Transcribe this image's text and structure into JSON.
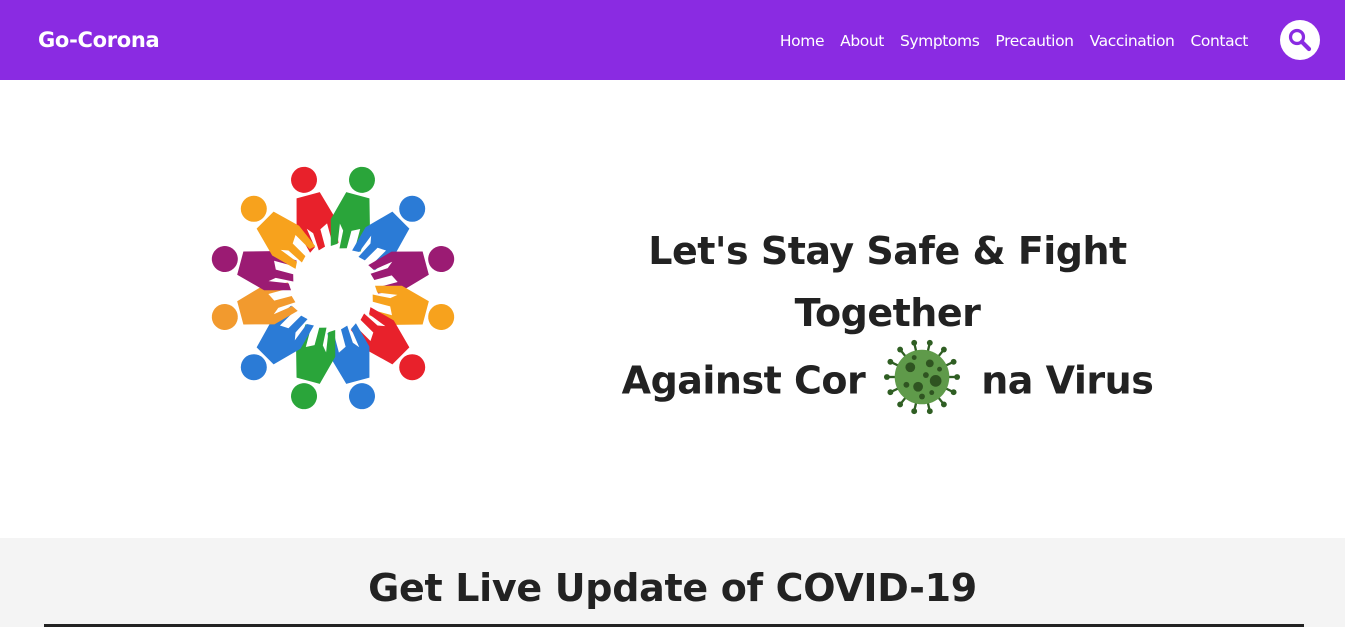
{
  "brand": {
    "name": "Go-Corona"
  },
  "nav": {
    "items": [
      {
        "label": "Home"
      },
      {
        "label": "About"
      },
      {
        "label": "Symptoms"
      },
      {
        "label": "Precaution"
      },
      {
        "label": "Vaccination"
      },
      {
        "label": "Contact"
      }
    ],
    "search_icon": "search-icon"
  },
  "hero": {
    "line1": "Let's Stay Safe & Fight Together",
    "line2_before": "Against Cor",
    "line2_after": "na Virus",
    "logo_icon": "people-circle-icon",
    "virus_icon": "virus-icon"
  },
  "live": {
    "title": "Get Live Update of COVID-19"
  },
  "colors": {
    "accent": "#8a2be2",
    "text": "#222222",
    "section_bg": "#f4f4f4"
  }
}
